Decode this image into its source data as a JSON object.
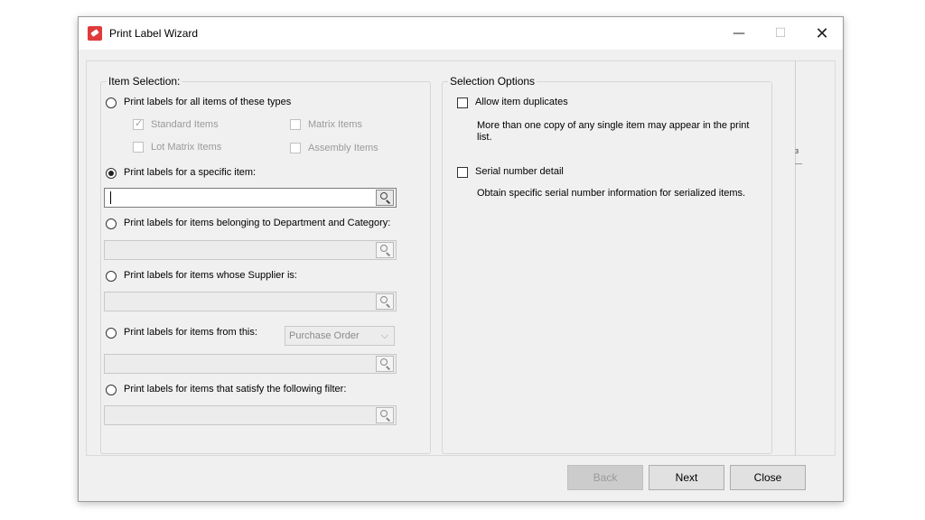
{
  "window": {
    "title": "Print Label Wizard",
    "controls": {
      "minimize": "—",
      "maximize": "☐",
      "close": "✕"
    }
  },
  "item_selection": {
    "legend": "Item Selection:",
    "options": [
      {
        "label": "Print labels for all items of these types",
        "selected": false
      },
      {
        "label": "Print labels for a specific item:",
        "selected": true
      },
      {
        "label": "Print labels for items belonging to Department and Category:",
        "selected": false
      },
      {
        "label": "Print labels for items whose Supplier is:",
        "selected": false
      },
      {
        "label": "Print labels for items from this:",
        "selected": false
      },
      {
        "label": "Print labels for items that satisfy the following filter:",
        "selected": false
      }
    ],
    "item_types": [
      {
        "label": "Standard Items",
        "checked": true
      },
      {
        "label": "Matrix Items",
        "checked": false
      },
      {
        "label": "Lot Matrix Items",
        "checked": false
      },
      {
        "label": "Assembly Items",
        "checked": false
      }
    ],
    "source_dropdown": {
      "selected": "Purchase Order",
      "chevron": "⌵"
    },
    "search_icon": "magnifier-icon"
  },
  "selection_options": {
    "legend": "Selection Options",
    "options": [
      {
        "label": "Allow item duplicates",
        "checked": false,
        "description": "More than one copy of any single item may appear in the print list."
      },
      {
        "label": "Serial number detail",
        "checked": false,
        "description": "Obtain specific serial number information for serialized items."
      }
    ]
  },
  "buttons": {
    "back": "Back",
    "next": "Next",
    "close": "Close"
  },
  "side_panel": {
    "edge_mark": "з"
  },
  "colors": {
    "app_icon": "#e03a3a",
    "dialog_bg": "#f0f0f0"
  }
}
